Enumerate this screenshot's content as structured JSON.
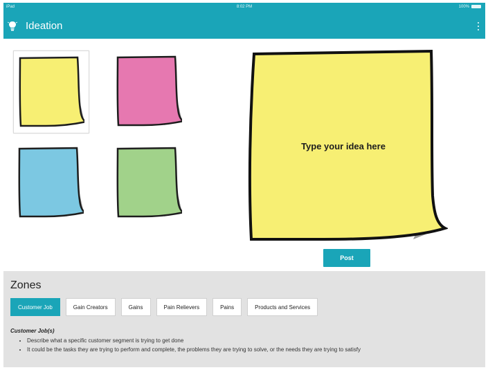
{
  "status_bar": {
    "carrier": "iPad",
    "time": "8:02 PM",
    "battery": "100%"
  },
  "app_bar": {
    "title": "Ideation",
    "icons": {
      "logo": "lightbulb-icon",
      "menu": "kebab-menu-icon"
    }
  },
  "palette": {
    "notes": [
      {
        "color": "#f7ef73",
        "selected": true
      },
      {
        "color": "#e678b0",
        "selected": false
      },
      {
        "color": "#7cc8e2",
        "selected": false
      },
      {
        "color": "#a1d28a",
        "selected": false
      }
    ]
  },
  "editor": {
    "placeholder": "Type your idea here",
    "note_color": "#f7ef73",
    "post_label": "Post"
  },
  "zones": {
    "heading": "Zones",
    "tabs": [
      {
        "label": "Customer Job",
        "active": true
      },
      {
        "label": "Gain Creators",
        "active": false
      },
      {
        "label": "Gains",
        "active": false
      },
      {
        "label": "Pain Relievers",
        "active": false
      },
      {
        "label": "Pains",
        "active": false
      },
      {
        "label": "Products and Services",
        "active": false
      }
    ],
    "description_title": "Customer Job(s)",
    "bullets": [
      "Describe what a specific customer segment is trying to get done",
      "It could be the tasks they are trying to perform and complete, the problems they are trying to solve, or the needs they are trying to satisfy"
    ]
  },
  "colors": {
    "accent": "#1aa5b8",
    "panel": "#e2e2e2"
  }
}
